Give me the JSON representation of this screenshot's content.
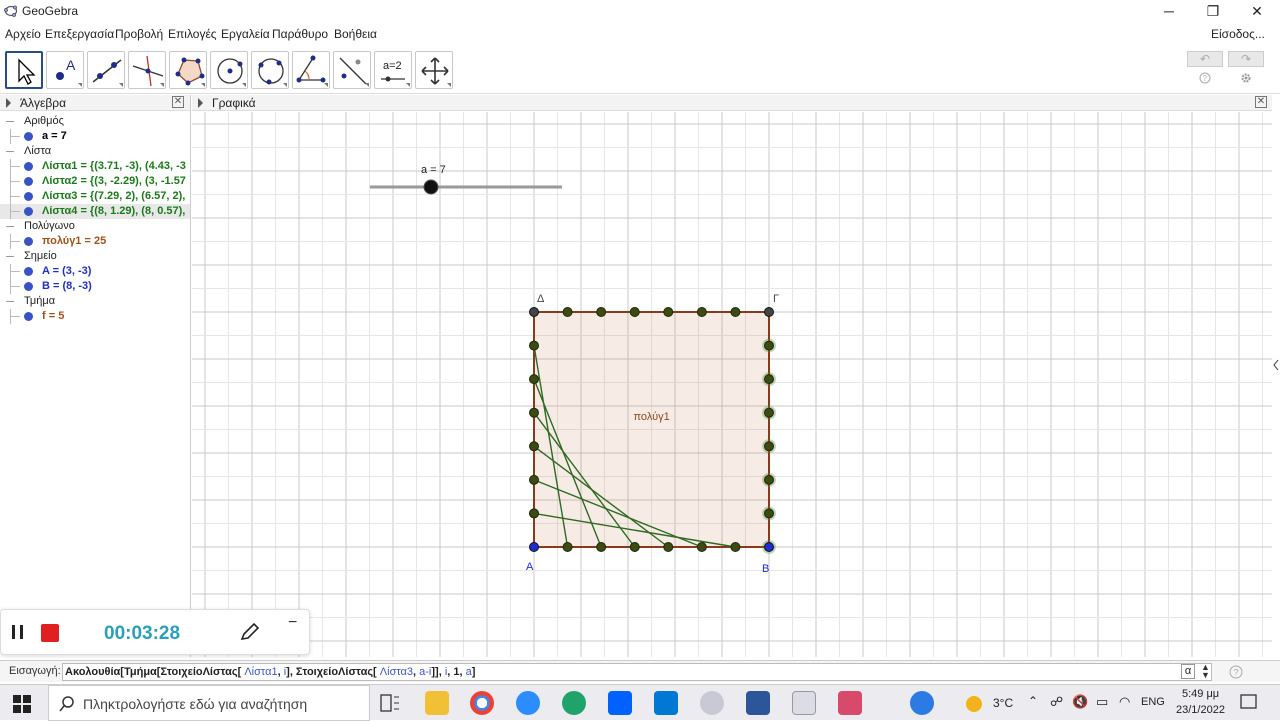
{
  "window": {
    "title": "GeoGebra",
    "controls": [
      "─",
      "❐",
      "✕"
    ]
  },
  "menu": [
    "Αρχείο",
    "Επεξεργασία",
    "Προβολή",
    "Επιλογές",
    "Εργαλεία",
    "Παράθυρο",
    "Βοήθεια"
  ],
  "signin": "Είσοδος...",
  "toolbar": {
    "tools": [
      "move-tool",
      "point-tool",
      "line-tool",
      "perpendicular-tool",
      "polygon-tool",
      "circle-tool",
      "circle-3points-tool",
      "angle-tool",
      "reflect-tool",
      "slider-tool",
      "move-view-tool"
    ],
    "slider_tool_label": "a=2",
    "undo": "↶",
    "redo": "↷"
  },
  "algebra": {
    "title": "Άλγεβρα",
    "rows": [
      {
        "type": "category",
        "text": "Αριθμός"
      },
      {
        "type": "item",
        "text": "a = 7",
        "color": "#000000"
      },
      {
        "type": "category",
        "text": "Λίστα"
      },
      {
        "type": "item",
        "text": "Λίστα1 = {(3.71, -3), (4.43, -3",
        "color": "#1a7a1a"
      },
      {
        "type": "item",
        "text": "Λίστα2 = {(3, -2.29), (3, -1.57",
        "color": "#1a7a1a"
      },
      {
        "type": "item",
        "text": "Λίστα3 = {(7.29, 2), (6.57, 2),",
        "color": "#1a7a1a"
      },
      {
        "type": "item",
        "text": "Λίστα4 = {(8, 1.29), (8, 0.57),",
        "color": "#1a7a1a",
        "selected": true
      },
      {
        "type": "category",
        "text": "Πολύγωνο"
      },
      {
        "type": "item",
        "text": "πολύγ1 = 25",
        "color": "#a0521a"
      },
      {
        "type": "category",
        "text": "Σημείο"
      },
      {
        "type": "item",
        "text": "A = (3, -3)",
        "color": "#2030c0"
      },
      {
        "type": "item",
        "text": "B = (8, -3)",
        "color": "#2030c0"
      },
      {
        "type": "category",
        "text": "Τμήμα"
      },
      {
        "type": "item",
        "text": "f = 5",
        "color": "#a0521a"
      }
    ]
  },
  "graphics": {
    "title": "Γραφικά",
    "slider_label": "a = 7",
    "slider_value": 7,
    "point_labels": {
      "A": "A",
      "B": "B",
      "C": "Γ",
      "D": "Δ"
    },
    "polygon_label": "πολύγ1"
  },
  "recorder": {
    "time": "00:03:28",
    "minimize": "−"
  },
  "input": {
    "label": "Εισαγωγή:",
    "parts": [
      {
        "t": "Ακολουθία[Τμήμα[ΣτοιχείοΛίστας[ ",
        "c": "black"
      },
      {
        "t": "Λίστα1",
        "c": "blue"
      },
      {
        "t": ", ",
        "c": "black"
      },
      {
        "t": "i",
        "c": "blue"
      },
      {
        "t": "], ΣτοιχείοΛίστας[ ",
        "c": "black"
      },
      {
        "t": "Λίστα3",
        "c": "blue"
      },
      {
        "t": ", ",
        "c": "black"
      },
      {
        "t": "a-i",
        "c": "blue"
      },
      {
        "t": "]], ",
        "c": "black"
      },
      {
        "t": "i",
        "c": "blue"
      },
      {
        "t": ", 1, ",
        "c": "black"
      },
      {
        "t": "a",
        "c": "blue"
      },
      {
        "t": "]",
        "c": "black"
      }
    ],
    "alpha": "α"
  },
  "taskbar": {
    "search_placeholder": "Πληκτρολογήστε εδώ για αναζήτηση",
    "weather": "3°C",
    "lang": "ENG",
    "time": "5:49 μμ",
    "date": "23/1/2022"
  }
}
